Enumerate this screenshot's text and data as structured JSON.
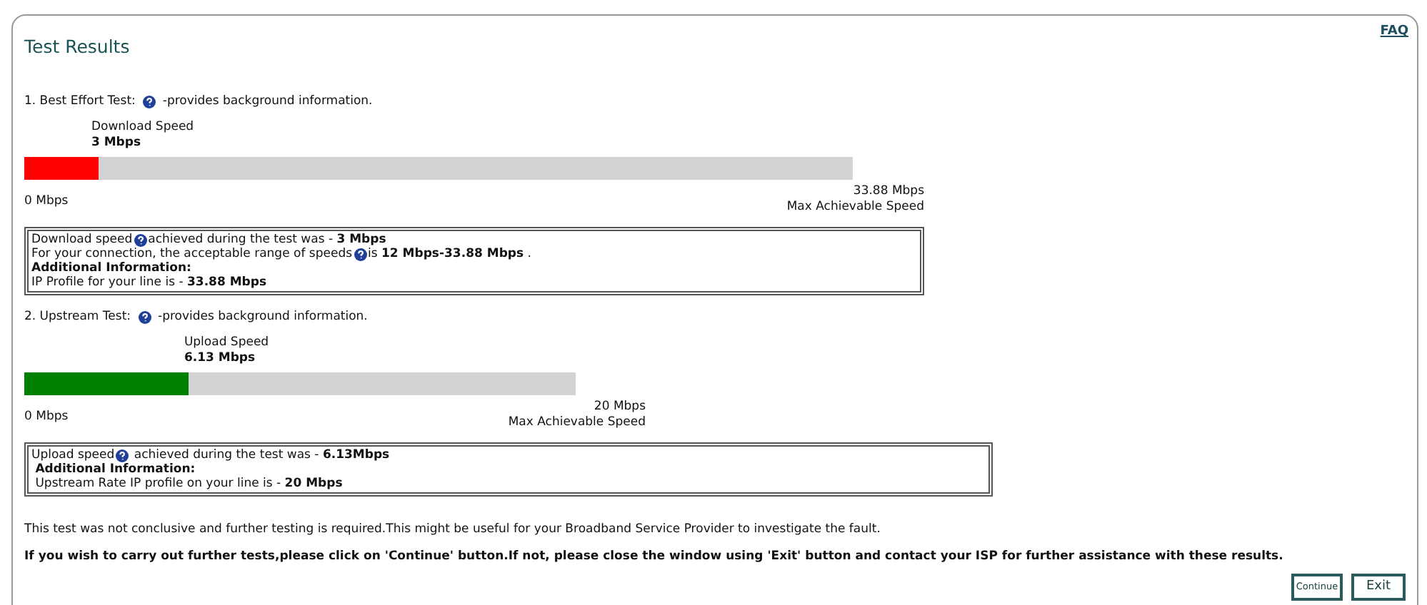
{
  "faq_link": "FAQ",
  "title": "Test Results",
  "tests": [
    {
      "kind": "download",
      "heading": "1. Best Effort Test:",
      "heading_after": "-provides background information.",
      "speed_label": "Download Speed",
      "speed_value": "3 Mbps",
      "level": 0.089,
      "min_label": "0 Mbps",
      "max_value": "33.88 Mbps",
      "max_label": "Max Achievable Speed",
      "info_lines": [
        [
          {
            "kind": "text",
            "text": "Download speed"
          },
          {
            "kind": "help"
          },
          {
            "kind": "text",
            "text": "achieved during the test was - **3 Mbps**"
          }
        ],
        [
          {
            "kind": "text",
            "text": "For your connection, the acceptable range of speeds"
          },
          {
            "kind": "help"
          },
          {
            "kind": "text",
            "text": "is **12 Mbps-33.88 Mbps** ."
          }
        ],
        [
          {
            "kind": "text",
            "text": "**Additional Information:**"
          }
        ],
        [
          {
            "kind": "text",
            "text": "IP Profile for your line is - **33.88 Mbps**"
          }
        ]
      ]
    },
    {
      "kind": "upload",
      "heading": "2. Upstream Test:",
      "heading_after": "-provides background information.",
      "speed_label": "Upload Speed",
      "speed_value": "6.13 Mbps",
      "level": 0.298,
      "min_label": "0 Mbps",
      "max_value": "20 Mbps",
      "max_label": "Max Achievable Speed",
      "info_lines": [
        [
          {
            "kind": "text",
            "text": "Upload speed"
          },
          {
            "kind": "help"
          },
          {
            "kind": "text",
            "text": " achieved during the test was - **6.13Mbps**"
          }
        ],
        [
          {
            "kind": "text",
            "text": " **Additional Information:**"
          }
        ],
        [
          {
            "kind": "text",
            "text": " Upstream Rate IP profile on your line is - **20 Mbps**"
          }
        ]
      ]
    }
  ],
  "note": "This test was not conclusive and further testing is required.This might be useful for your Broadband Service Provider to investigate the fault.",
  "instruction": "If you wish to carry out further tests,please click on 'Continue' button.If not, please close the window using 'Exit' button and contact your ISP for further assistance with these results.",
  "buttons": [
    {
      "kind": "continue",
      "label": "Continue"
    },
    {
      "kind": "exit",
      "label": "Exit"
    }
  ]
}
